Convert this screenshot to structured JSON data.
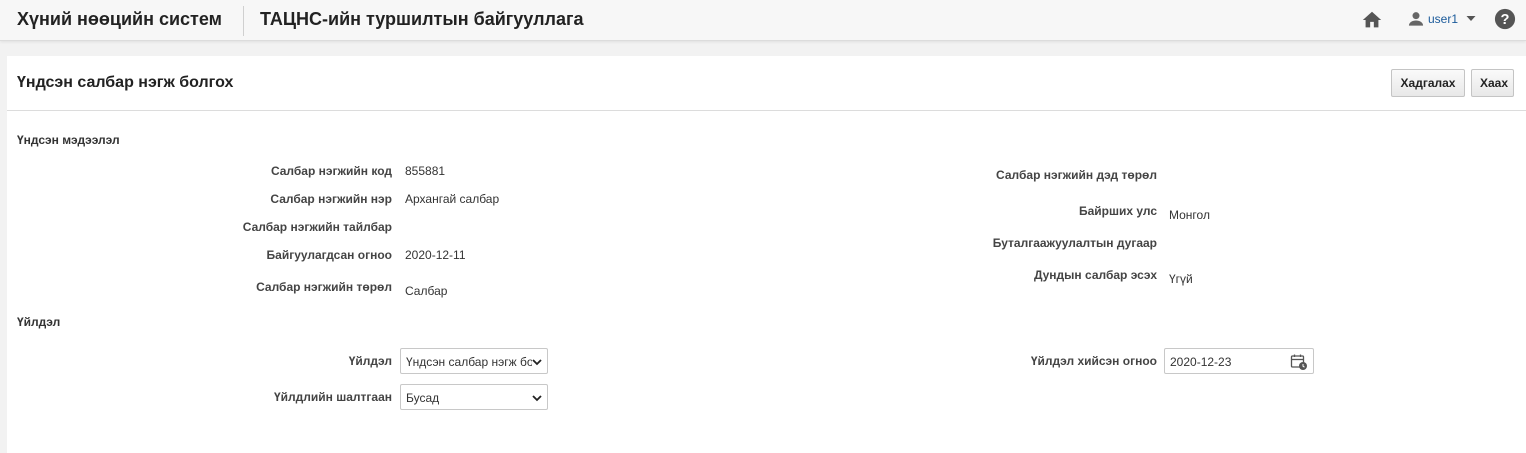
{
  "header": {
    "app_title": "Хүний нөөцийн систем",
    "org_title": "ТАЦНС-ийн туршилтын байгууллага",
    "user_name": "user1",
    "icons": [
      "home-icon",
      "user-icon",
      "caret-down-icon",
      "help-icon"
    ]
  },
  "page": {
    "title": "Үндсэн салбар нэгж болгох",
    "save_label": "Хадгалах",
    "close_label": "Хаах"
  },
  "basic_info": {
    "section_title": "Үндсэн мэдээлэл",
    "left": [
      {
        "label": "Салбар нэгжийн код",
        "value": "855881"
      },
      {
        "label": "Салбар нэгжийн нэр",
        "value": "Архангай салбар"
      },
      {
        "label": "Салбар нэгжийн тайлбар",
        "value": ""
      },
      {
        "label": "Байгуулагдсан огноо",
        "value": "2020-12-11"
      },
      {
        "label": "Салбар нэгжийн төрөл",
        "value": "Салбар"
      }
    ],
    "right": [
      {
        "label": "Салбар нэгжийн дэд төрөл",
        "value": ""
      },
      {
        "label": "Байрших улс",
        "value": "Монгол"
      },
      {
        "label": "Буталгаажуулалтын дугаар",
        "value": ""
      },
      {
        "label": "Дундын салбар эсэх",
        "value": "Үгүй"
      }
    ]
  },
  "action": {
    "section_title": "Үйлдэл",
    "action_label": "Үйлдэл",
    "action_value": "Үндсэн салбар нэгж болгох",
    "reason_label": "Үйлдлийн шалтгаан",
    "reason_value": "Бусад",
    "date_label": "Үйлдэл хийсэн огноо",
    "date_value": "2020-12-23"
  }
}
